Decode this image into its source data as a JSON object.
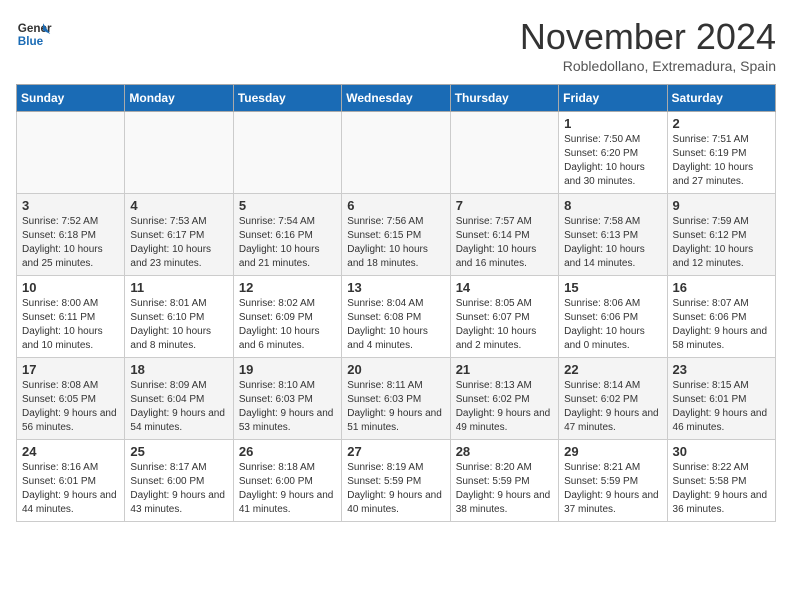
{
  "header": {
    "logo_line1": "General",
    "logo_line2": "Blue",
    "month": "November 2024",
    "location": "Robledollano, Extremadura, Spain"
  },
  "days_of_week": [
    "Sunday",
    "Monday",
    "Tuesday",
    "Wednesday",
    "Thursday",
    "Friday",
    "Saturday"
  ],
  "weeks": [
    [
      {
        "day": "",
        "empty": true
      },
      {
        "day": "",
        "empty": true
      },
      {
        "day": "",
        "empty": true
      },
      {
        "day": "",
        "empty": true
      },
      {
        "day": "",
        "empty": true
      },
      {
        "day": "1",
        "sunrise": "7:50 AM",
        "sunset": "6:20 PM",
        "daylight": "10 hours and 30 minutes."
      },
      {
        "day": "2",
        "sunrise": "7:51 AM",
        "sunset": "6:19 PM",
        "daylight": "10 hours and 27 minutes."
      }
    ],
    [
      {
        "day": "3",
        "sunrise": "7:52 AM",
        "sunset": "6:18 PM",
        "daylight": "10 hours and 25 minutes."
      },
      {
        "day": "4",
        "sunrise": "7:53 AM",
        "sunset": "6:17 PM",
        "daylight": "10 hours and 23 minutes."
      },
      {
        "day": "5",
        "sunrise": "7:54 AM",
        "sunset": "6:16 PM",
        "daylight": "10 hours and 21 minutes."
      },
      {
        "day": "6",
        "sunrise": "7:56 AM",
        "sunset": "6:15 PM",
        "daylight": "10 hours and 18 minutes."
      },
      {
        "day": "7",
        "sunrise": "7:57 AM",
        "sunset": "6:14 PM",
        "daylight": "10 hours and 16 minutes."
      },
      {
        "day": "8",
        "sunrise": "7:58 AM",
        "sunset": "6:13 PM",
        "daylight": "10 hours and 14 minutes."
      },
      {
        "day": "9",
        "sunrise": "7:59 AM",
        "sunset": "6:12 PM",
        "daylight": "10 hours and 12 minutes."
      }
    ],
    [
      {
        "day": "10",
        "sunrise": "8:00 AM",
        "sunset": "6:11 PM",
        "daylight": "10 hours and 10 minutes."
      },
      {
        "day": "11",
        "sunrise": "8:01 AM",
        "sunset": "6:10 PM",
        "daylight": "10 hours and 8 minutes."
      },
      {
        "day": "12",
        "sunrise": "8:02 AM",
        "sunset": "6:09 PM",
        "daylight": "10 hours and 6 minutes."
      },
      {
        "day": "13",
        "sunrise": "8:04 AM",
        "sunset": "6:08 PM",
        "daylight": "10 hours and 4 minutes."
      },
      {
        "day": "14",
        "sunrise": "8:05 AM",
        "sunset": "6:07 PM",
        "daylight": "10 hours and 2 minutes."
      },
      {
        "day": "15",
        "sunrise": "8:06 AM",
        "sunset": "6:06 PM",
        "daylight": "10 hours and 0 minutes."
      },
      {
        "day": "16",
        "sunrise": "8:07 AM",
        "sunset": "6:06 PM",
        "daylight": "9 hours and 58 minutes."
      }
    ],
    [
      {
        "day": "17",
        "sunrise": "8:08 AM",
        "sunset": "6:05 PM",
        "daylight": "9 hours and 56 minutes."
      },
      {
        "day": "18",
        "sunrise": "8:09 AM",
        "sunset": "6:04 PM",
        "daylight": "9 hours and 54 minutes."
      },
      {
        "day": "19",
        "sunrise": "8:10 AM",
        "sunset": "6:03 PM",
        "daylight": "9 hours and 53 minutes."
      },
      {
        "day": "20",
        "sunrise": "8:11 AM",
        "sunset": "6:03 PM",
        "daylight": "9 hours and 51 minutes."
      },
      {
        "day": "21",
        "sunrise": "8:13 AM",
        "sunset": "6:02 PM",
        "daylight": "9 hours and 49 minutes."
      },
      {
        "day": "22",
        "sunrise": "8:14 AM",
        "sunset": "6:02 PM",
        "daylight": "9 hours and 47 minutes."
      },
      {
        "day": "23",
        "sunrise": "8:15 AM",
        "sunset": "6:01 PM",
        "daylight": "9 hours and 46 minutes."
      }
    ],
    [
      {
        "day": "24",
        "sunrise": "8:16 AM",
        "sunset": "6:01 PM",
        "daylight": "9 hours and 44 minutes."
      },
      {
        "day": "25",
        "sunrise": "8:17 AM",
        "sunset": "6:00 PM",
        "daylight": "9 hours and 43 minutes."
      },
      {
        "day": "26",
        "sunrise": "8:18 AM",
        "sunset": "6:00 PM",
        "daylight": "9 hours and 41 minutes."
      },
      {
        "day": "27",
        "sunrise": "8:19 AM",
        "sunset": "5:59 PM",
        "daylight": "9 hours and 40 minutes."
      },
      {
        "day": "28",
        "sunrise": "8:20 AM",
        "sunset": "5:59 PM",
        "daylight": "9 hours and 38 minutes."
      },
      {
        "day": "29",
        "sunrise": "8:21 AM",
        "sunset": "5:59 PM",
        "daylight": "9 hours and 37 minutes."
      },
      {
        "day": "30",
        "sunrise": "8:22 AM",
        "sunset": "5:58 PM",
        "daylight": "9 hours and 36 minutes."
      }
    ]
  ]
}
